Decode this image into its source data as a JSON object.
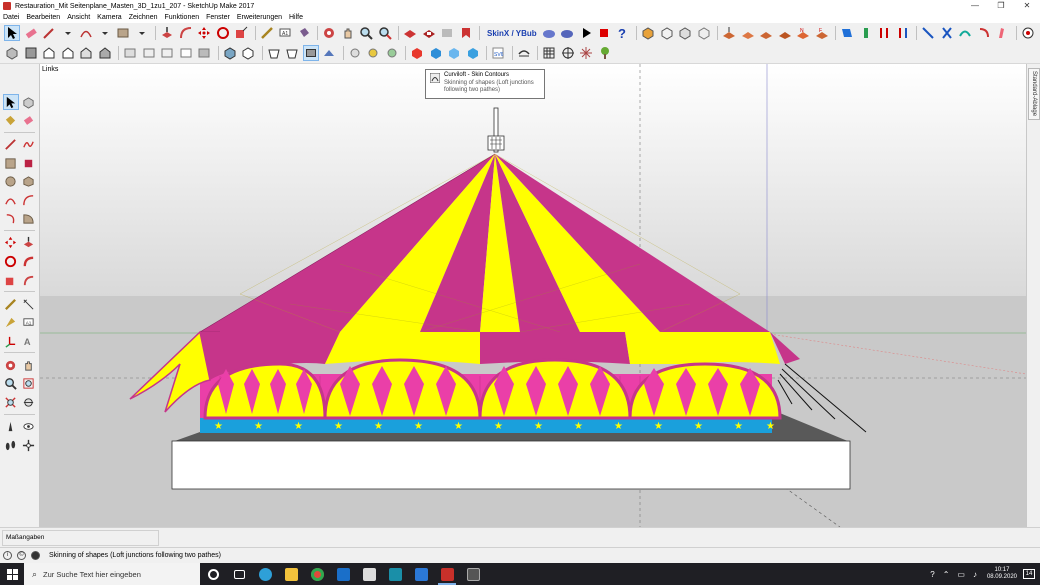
{
  "window": {
    "title": "Restauration_Mit Seitenplane_Masten_3D_1zu1_207 - SketchUp Make 2017",
    "controls": [
      "minimize-icon",
      "maximize-icon",
      "close-icon"
    ]
  },
  "menubar": {
    "items": [
      "Datei",
      "Bearbeiten",
      "Ansicht",
      "Kamera",
      "Zeichnen",
      "Funktionen",
      "Fenster",
      "Erweiterungen",
      "Hilfe"
    ]
  },
  "toolbar": {
    "skinx_label": "SkinX / YBub"
  },
  "viewport": {
    "scene_label": "Links",
    "colors": {
      "sky_top": "#ffffff",
      "sky_bottom": "#d6d6d6",
      "ground": "#c8c8c8",
      "tent_yellow": "#ffff00",
      "tent_magenta": "#c6358a",
      "tent_blue": "#1aa0dc",
      "base_white": "#ffffff"
    }
  },
  "tooltip": {
    "title": "Curviloft - Skin Contours",
    "line1": "Skinning of shapes (Loft junctions",
    "line2": "following two pathes)"
  },
  "tray": {
    "tab_label": "Standard-Ablage"
  },
  "measurements": {
    "label": "Maßangaben"
  },
  "statusbar": {
    "text": "Skinning of shapes (Loft junctions following two pathes)"
  },
  "taskbar": {
    "search_placeholder": "Zur Suche Text hier eingeben",
    "time": "10:17",
    "date": "08.09.2020",
    "notifications": "14"
  }
}
